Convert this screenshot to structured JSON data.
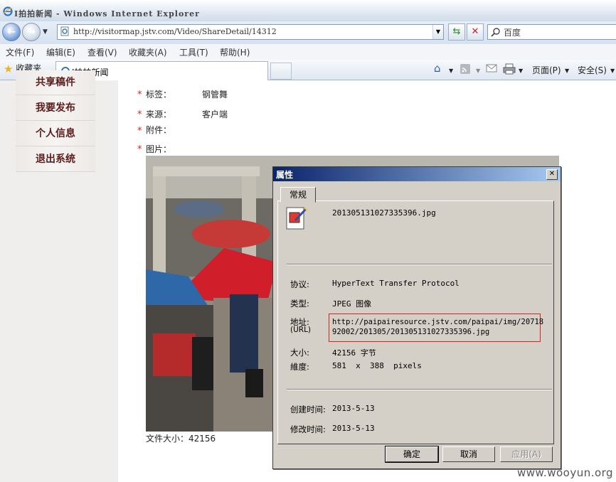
{
  "window": {
    "title": "I拍拍新闻 - Windows Internet Explorer"
  },
  "nav": {
    "address": "http://visitormap.jstv.com/Video/ShareDetail/14312",
    "search_placeholder": "百度"
  },
  "menu": {
    "items": [
      "文件(F)",
      "编辑(E)",
      "查看(V)",
      "收藏夹(A)",
      "工具(T)",
      "帮助(H)"
    ]
  },
  "favbar": {
    "favorites_label": "收藏夹",
    "tab_title": "I拍拍新闻",
    "page_label": "页面(P)",
    "safety_label": "安全(S)"
  },
  "sidebar": {
    "items": [
      {
        "label": "共享稿件"
      },
      {
        "label": "我要发布"
      },
      {
        "label": "个人信息"
      },
      {
        "label": "退出系统"
      }
    ]
  },
  "fields": [
    {
      "label": "标签：",
      "value": "钢管舞"
    },
    {
      "label": "来源：",
      "value": "客户端"
    },
    {
      "label": "附件：",
      "value": ""
    },
    {
      "label": "图片：",
      "value": ""
    }
  ],
  "file_size_text": "文件大小：42156",
  "dialog": {
    "title": "属性",
    "tab": "常规",
    "filename": "201305131027335396.jpg",
    "protocol_label": "协议:",
    "protocol_value": "HyperText Transfer Protocol",
    "type_label": "类型:",
    "type_value": "JPEG 图像",
    "address_label": "地址:",
    "address_label_sub": "(URL)",
    "address_line1": "http://paipairesource.jstv.com/paipai/img/20718",
    "address_line2": "92002/201305/201305131027335396.jpg",
    "size_label": "大小:",
    "size_value": "42156 字节",
    "dims_label": "維度:",
    "dims_value": "581  x  388  pixels",
    "created_label": "创建时间:",
    "created_value": "2013-5-13",
    "modified_label": "修改时间:",
    "modified_value": "2013-5-13",
    "ok": "确定",
    "cancel": "取消",
    "apply": "应用(A)"
  },
  "watermark": "www.wooyun.org",
  "icons": [
    "ie-logo-icon",
    "back-icon",
    "forward-icon",
    "refresh-icon",
    "stop-icon",
    "search-icon",
    "favorites-star-icon",
    "home-icon",
    "feed-icon",
    "print-icon",
    "image-file-icon"
  ]
}
